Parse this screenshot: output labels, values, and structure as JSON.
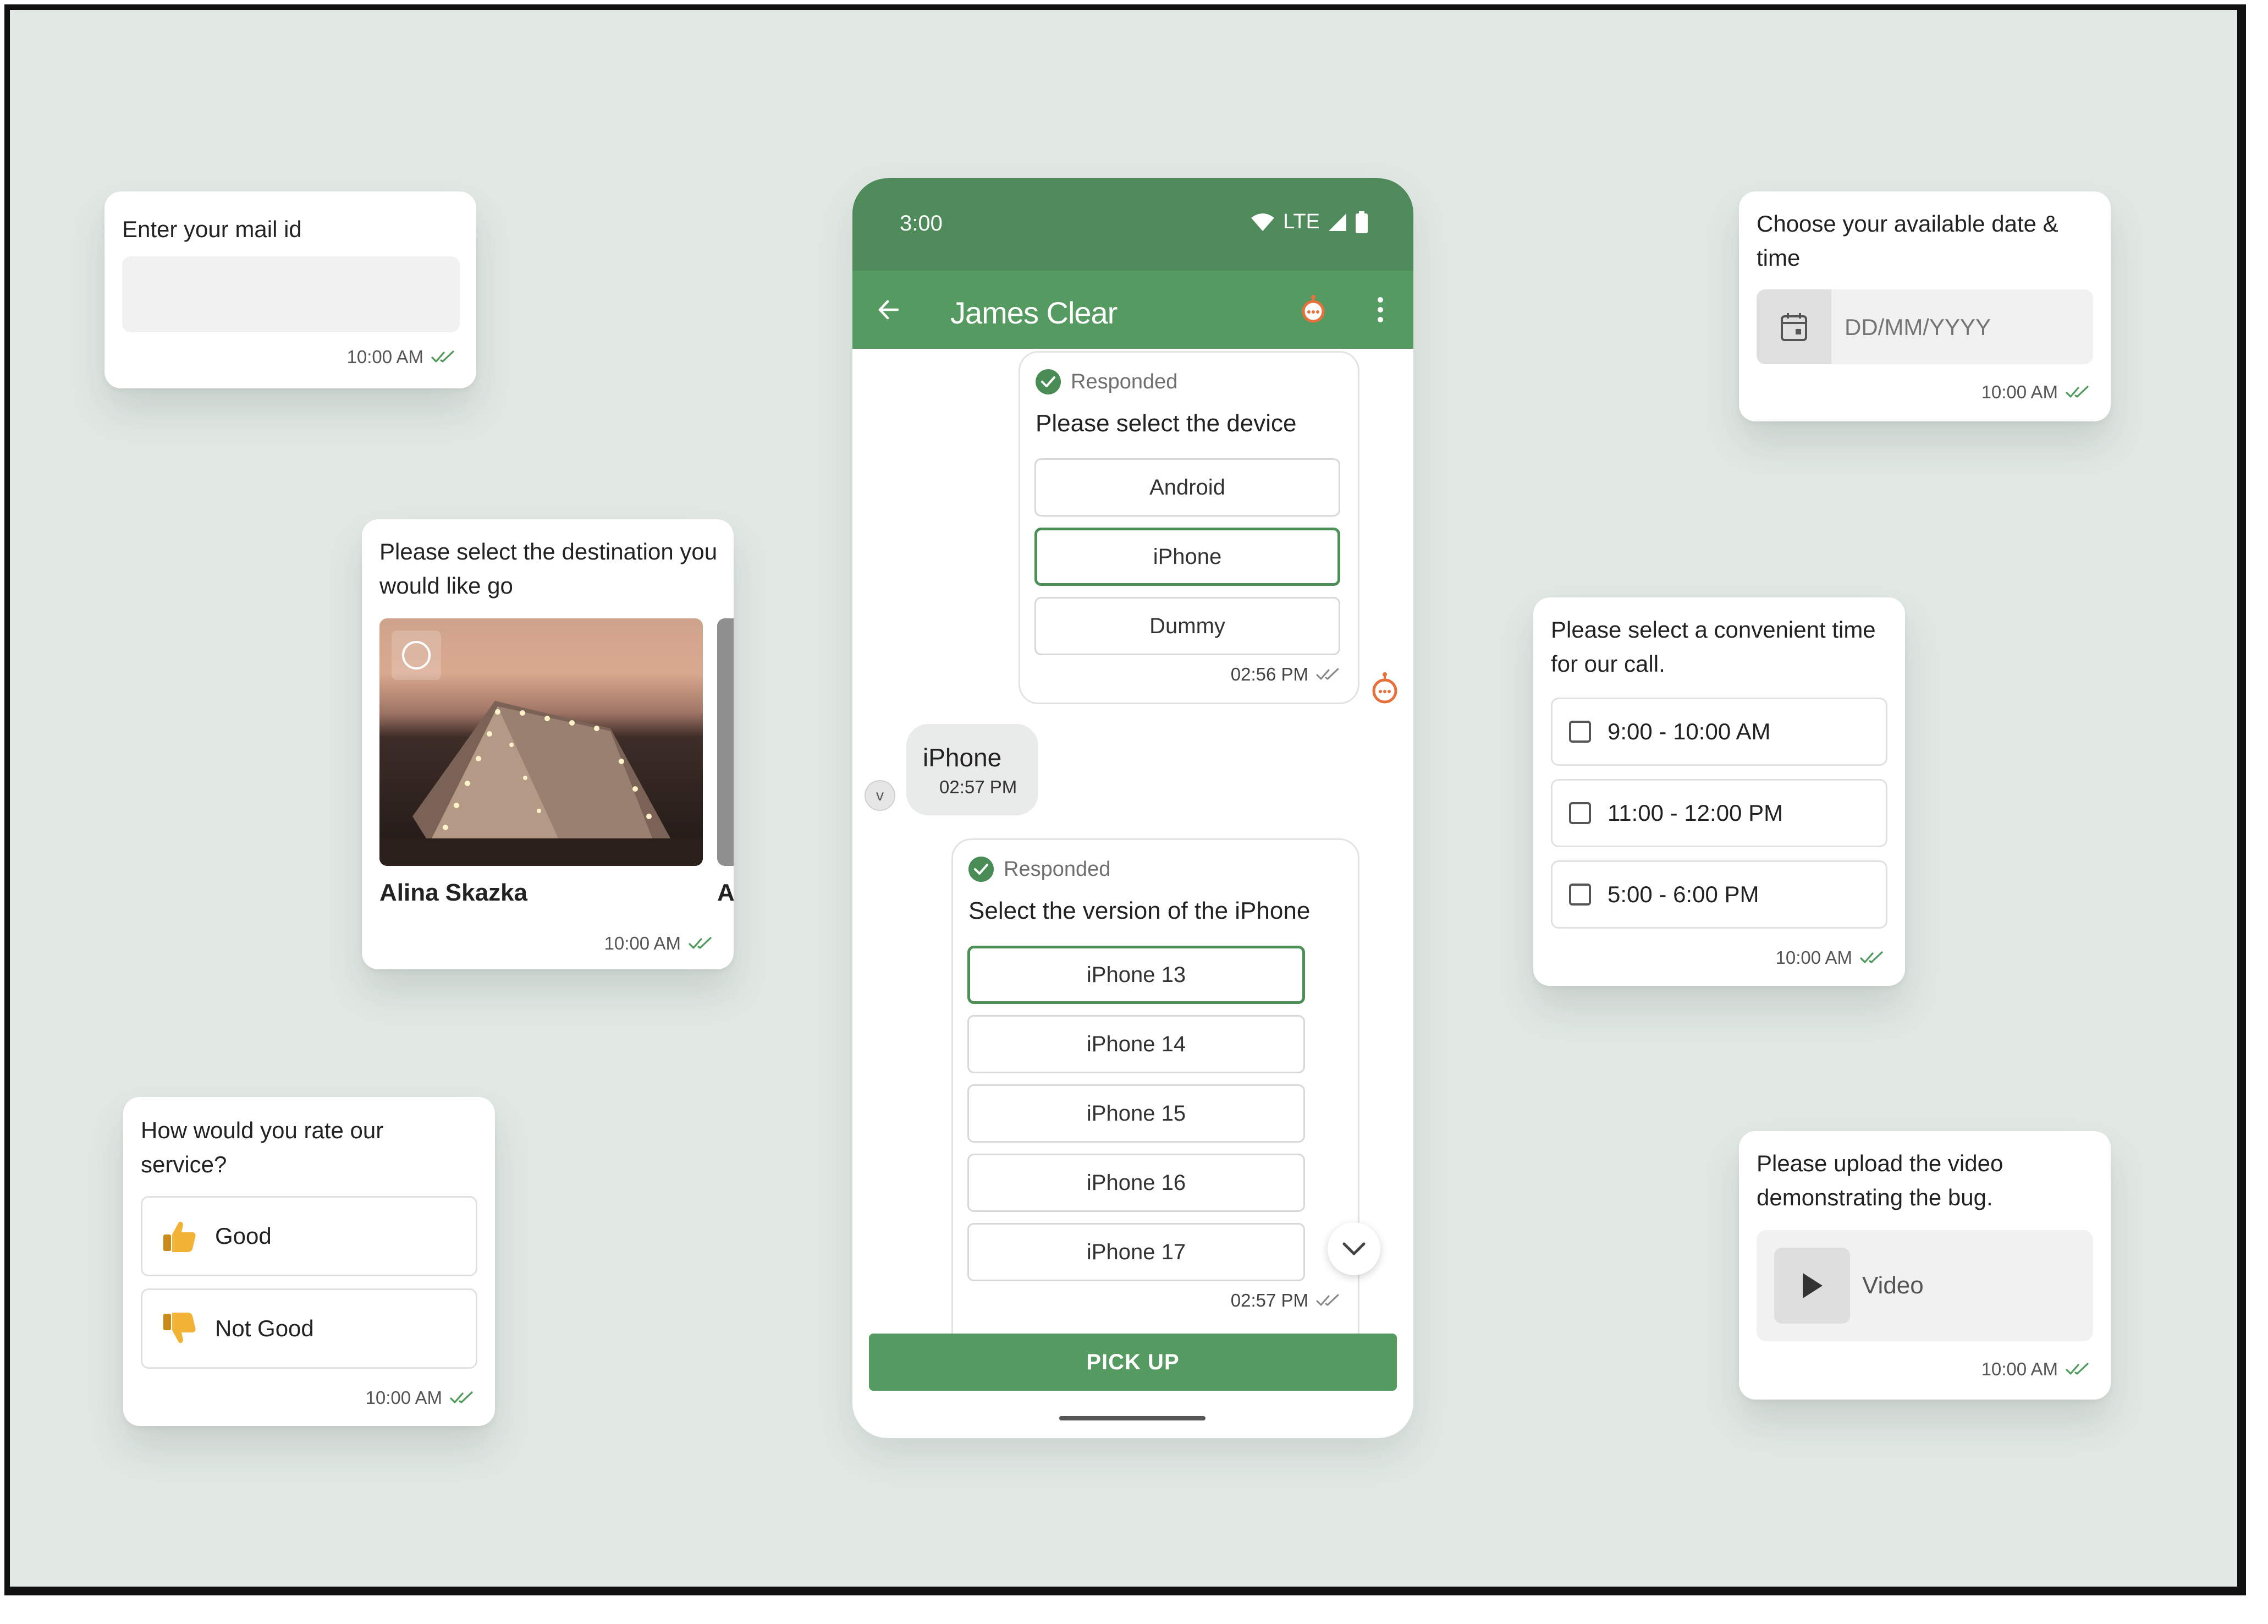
{
  "colors": {
    "background": "#e2e9e5",
    "brand_green": "#559a61",
    "status_bar_green": "#4e8a5a",
    "tick_green": "#4f9a5b",
    "bot_orange": "#e8703a"
  },
  "mail_card": {
    "title": "Enter your mail id",
    "input_value": "",
    "time": "10:00 AM"
  },
  "destination_card": {
    "title": "Please select the destination you would like go",
    "items": [
      {
        "caption": "Alina Skazka"
      },
      {
        "caption": "A"
      }
    ],
    "time": "10:00 AM"
  },
  "rating_card": {
    "title": "How would you rate our service?",
    "options": [
      {
        "icon": "thumbs-up-icon",
        "label": "Good"
      },
      {
        "icon": "thumbs-down-icon",
        "label": "Not Good"
      }
    ],
    "time": "10:00 AM"
  },
  "phone": {
    "status_bar": {
      "time": "3:00",
      "network": "LTE"
    },
    "app_bar": {
      "title": "James Clear"
    },
    "device_question": {
      "status": "Responded",
      "question": "Please select the device",
      "options": [
        "Android",
        "iPhone",
        "Dummy"
      ],
      "selected": "iPhone",
      "time": "02:56 PM"
    },
    "user_reply": {
      "avatar_initial": "v",
      "text": "iPhone",
      "time": "02:57 PM"
    },
    "version_question": {
      "status": "Responded",
      "question": "Select the version of the iPhone",
      "options": [
        "iPhone 13",
        "iPhone 14",
        "iPhone 15",
        "iPhone 16",
        "iPhone 17"
      ],
      "selected": "iPhone 13",
      "time": "02:57 PM"
    },
    "action_button": "PICK UP"
  },
  "date_card": {
    "title": "Choose your available date & time",
    "placeholder": "DD/MM/YYYY",
    "time": "10:00 AM"
  },
  "call_time_card": {
    "title": "Please select a convenient time for our call.",
    "options": [
      "9:00 - 10:00 AM",
      "11:00 - 12:00 PM",
      "5:00 - 6:00 PM"
    ],
    "time": "10:00 AM"
  },
  "video_card": {
    "title": "Please upload the video demonstrating the bug.",
    "upload_label": "Video",
    "time": "10:00 AM"
  }
}
